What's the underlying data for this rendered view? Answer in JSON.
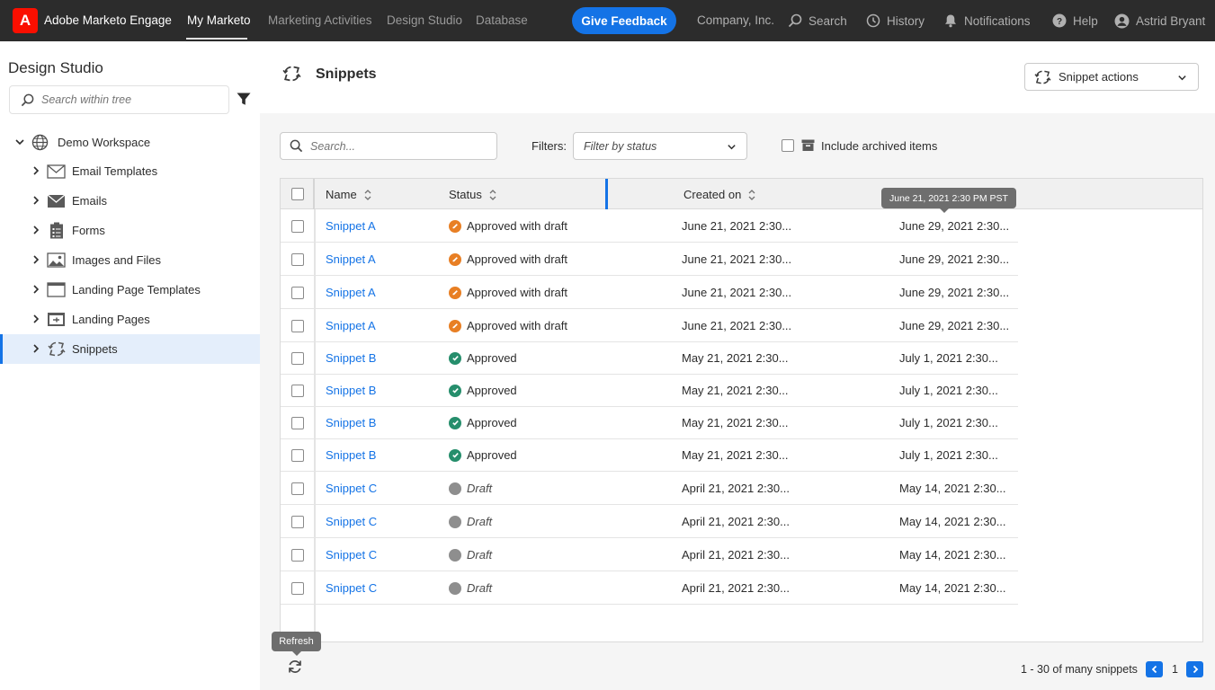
{
  "app": {
    "name": "Adobe Marketo Engage",
    "logo_letter": "A",
    "brand_color": "#fa0f00",
    "accent_color": "#1473e6"
  },
  "topnav": {
    "items": [
      {
        "label": "My Marketo",
        "active": true
      },
      {
        "label": "Marketing Activities",
        "active": false
      },
      {
        "label": "Design Studio",
        "active": false
      },
      {
        "label": "Database",
        "active": false
      }
    ],
    "feedback_label": "Give Feedback",
    "company": "Company, Inc.",
    "search_label": "Search",
    "history_label": "History",
    "notifications_label": "Notifications",
    "help_label": "Help",
    "user_name": "Astrid Bryant"
  },
  "sidebar": {
    "title": "Design Studio",
    "search_placeholder": "Search within tree",
    "root": {
      "label": "Demo Workspace",
      "icon": "globe-icon",
      "expanded": true
    },
    "items": [
      {
        "label": "Email Templates",
        "icon": "email-template-icon",
        "selected": false
      },
      {
        "label": "Emails",
        "icon": "envelope-icon",
        "selected": false
      },
      {
        "label": "Forms",
        "icon": "clipboard-icon",
        "selected": false
      },
      {
        "label": "Images and Files",
        "icon": "image-icon",
        "selected": false
      },
      {
        "label": "Landing Page Templates",
        "icon": "window-icon",
        "selected": false
      },
      {
        "label": "Landing Pages",
        "icon": "landing-page-icon",
        "selected": false
      },
      {
        "label": "Snippets",
        "icon": "snippet-icon",
        "selected": true
      }
    ]
  },
  "main": {
    "title": "Snippets",
    "actions_label": "Snippet actions",
    "search_placeholder": "Search...",
    "filters_label": "Filters:",
    "filter_select_value": "Filter by status",
    "include_archived_label": "Include archived items",
    "include_archived_checked": false,
    "columns": [
      {
        "label": "Name",
        "sortable": true
      },
      {
        "label": "Status",
        "sortable": true
      },
      {
        "label": "Created on",
        "sortable": true
      }
    ],
    "header_tooltip": "June 21, 2021 2:30 PM PST",
    "status_colors": {
      "Approved with draft": "#e87f24",
      "Approved": "#268e6c",
      "Draft": "#8e8e8e"
    },
    "rows": [
      {
        "name": "Snippet A",
        "status": "Approved with draft",
        "created": "June 21, 2021 2:30...",
        "modified": "June 29, 2021 2:30..."
      },
      {
        "name": "Snippet A",
        "status": "Approved with draft",
        "created": "June 21, 2021 2:30...",
        "modified": "June 29, 2021 2:30..."
      },
      {
        "name": "Snippet A",
        "status": "Approved with draft",
        "created": "June 21, 2021 2:30...",
        "modified": "June 29, 2021 2:30..."
      },
      {
        "name": "Snippet A",
        "status": "Approved with draft",
        "created": "June 21, 2021 2:30...",
        "modified": "June 29, 2021 2:30..."
      },
      {
        "name": "Snippet B",
        "status": "Approved",
        "created": "May 21, 2021 2:30...",
        "modified": "July 1, 2021 2:30..."
      },
      {
        "name": "Snippet B",
        "status": "Approved",
        "created": "May 21, 2021 2:30...",
        "modified": "July 1, 2021 2:30..."
      },
      {
        "name": "Snippet B",
        "status": "Approved",
        "created": "May 21, 2021 2:30...",
        "modified": "July 1, 2021 2:30..."
      },
      {
        "name": "Snippet B",
        "status": "Approved",
        "created": "May 21, 2021 2:30...",
        "modified": "July 1, 2021 2:30..."
      },
      {
        "name": "Snippet C",
        "status": "Draft",
        "created": "April 21, 2021 2:30...",
        "modified": "May 14, 2021 2:30..."
      },
      {
        "name": "Snippet C",
        "status": "Draft",
        "created": "April 21, 2021 2:30...",
        "modified": "May 14, 2021 2:30..."
      },
      {
        "name": "Snippet C",
        "status": "Draft",
        "created": "April 21, 2021 2:30...",
        "modified": "May 14, 2021 2:30..."
      },
      {
        "name": "Snippet C",
        "status": "Draft",
        "created": "April 21, 2021 2:30...",
        "modified": "May 14, 2021 2:30..."
      }
    ],
    "refresh_tooltip": "Refresh",
    "pager": {
      "summary": "1 - 30 of many snippets",
      "current_page": "1"
    }
  }
}
